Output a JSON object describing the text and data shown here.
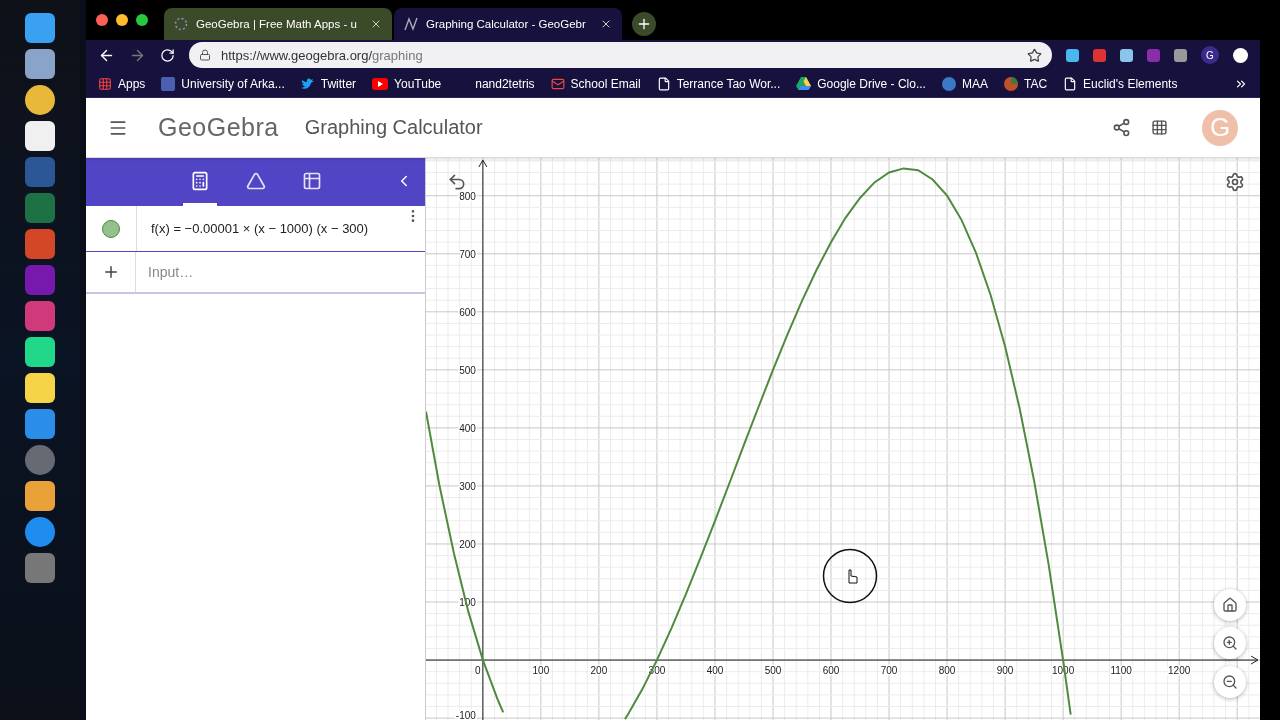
{
  "browser": {
    "tabs": [
      {
        "title": "GeoGebra | Free Math Apps - u",
        "kind": "geogebra",
        "selected": false
      },
      {
        "title": "Graphing Calculator - GeoGebr",
        "kind": "graph",
        "selected": true
      }
    ],
    "url_host": "https://www.geogebra.org/",
    "url_path": "graphing",
    "profile_initial": "G",
    "bookmarks": [
      {
        "label": "Apps",
        "kind": "apps"
      },
      {
        "label": "University of Arka...",
        "kind": "school"
      },
      {
        "label": "Twitter",
        "kind": "bird"
      },
      {
        "label": "YouTube",
        "kind": "video"
      },
      {
        "label": "nand2tetris",
        "kind": "none"
      },
      {
        "label": "School Email",
        "kind": "mail"
      },
      {
        "label": "Terrance Tao Wor...",
        "kind": "page"
      },
      {
        "label": "Google Drive - Clo...",
        "kind": "drive"
      },
      {
        "label": "MAA",
        "kind": "globe"
      },
      {
        "label": "TAC",
        "kind": "ball"
      },
      {
        "label": "Euclid's Elements",
        "kind": "page"
      }
    ]
  },
  "app": {
    "logo": "GeoGebra",
    "title": "Graphing Calculator",
    "avatar": "G"
  },
  "algebra": {
    "tabs": [
      {
        "kind": "algebra",
        "selected": true
      },
      {
        "kind": "tools",
        "selected": false
      },
      {
        "kind": "table",
        "selected": false
      }
    ],
    "entries": [
      {
        "formula": "f(x) = −0.00001 × (x − 1000) (x − 300)",
        "color": "#93c08c"
      }
    ],
    "input": {
      "placeholder": "Input…"
    }
  },
  "graph": {
    "chart_data": {
      "type": "line",
      "grid": true,
      "x": [
        -98,
        -75,
        -50,
        -25,
        0,
        25,
        35,
        50,
        245,
        250,
        275,
        300,
        325,
        350,
        375,
        400,
        425,
        450,
        475,
        500,
        525,
        550,
        575,
        600,
        625,
        650,
        675,
        700,
        725,
        750,
        775,
        800,
        825,
        850,
        875,
        900,
        925,
        950,
        975,
        1000,
        1013
      ],
      "series": [
        {
          "color": "#4f8a3f",
          "values": [
            428,
            302,
            184,
            83,
            0,
            -67,
            -90,
            null,
            -102,
            -94,
            -50,
            0,
            55,
            114,
            176,
            240,
            305,
            371,
            436,
            500,
            561,
            619,
            672,
            720,
            762,
            796,
            823,
            840,
            847,
            844,
            828,
            800,
            758,
            701,
            629,
            540,
            434,
            309,
            165,
            0,
            -94
          ]
        }
      ],
      "xlim": [
        -98,
        1341
      ],
      "ylim": [
        -105,
        865
      ],
      "xticks": [
        0,
        100,
        200,
        300,
        400,
        500,
        600,
        700,
        800,
        900,
        1000,
        1100,
        1200
      ],
      "yticks": [
        -100,
        100,
        200,
        300,
        400,
        500,
        600,
        700,
        800
      ]
    }
  }
}
